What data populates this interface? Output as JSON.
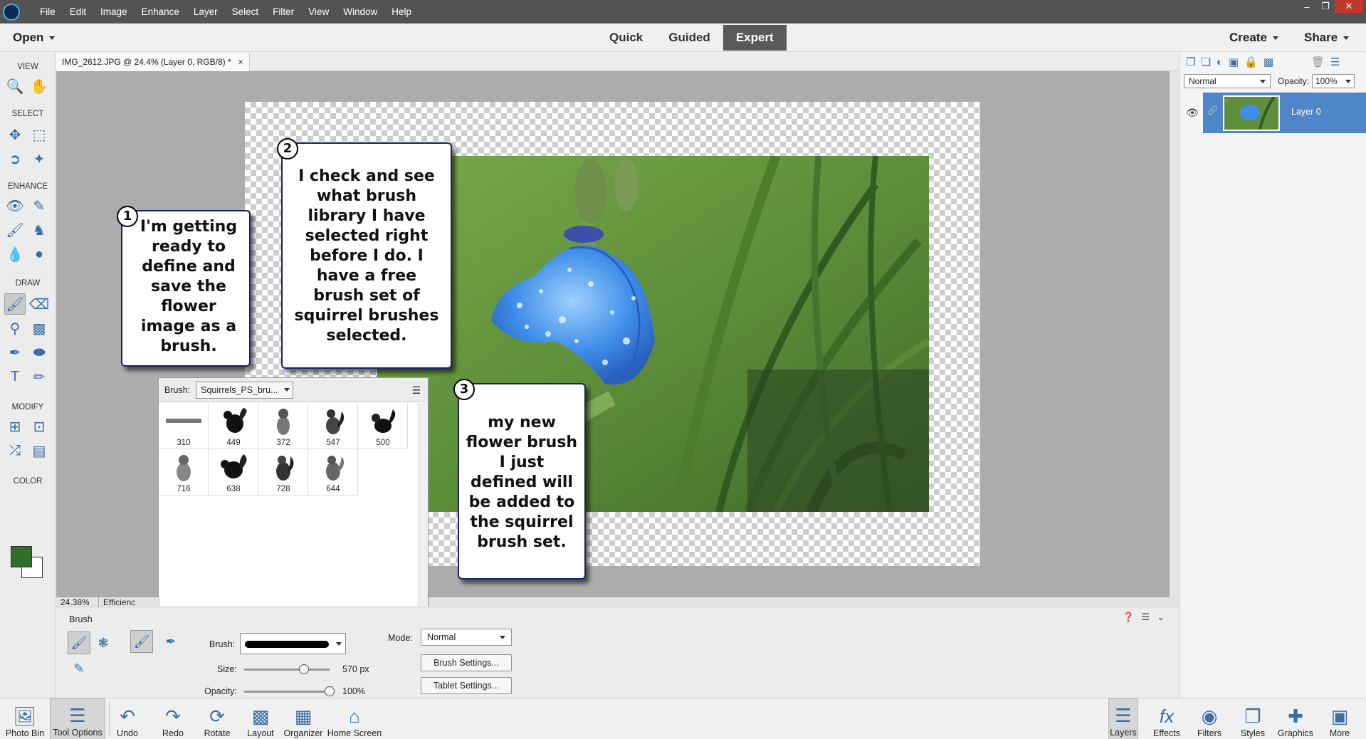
{
  "app": {
    "menu": [
      "File",
      "Edit",
      "Image",
      "Enhance",
      "Layer",
      "Select",
      "Filter",
      "View",
      "Window",
      "Help"
    ]
  },
  "topbar": {
    "open_label": "Open",
    "modes": [
      "Quick",
      "Guided",
      "Expert"
    ],
    "active_mode": "Expert",
    "create_label": "Create",
    "share_label": "Share"
  },
  "toolbox": {
    "sections": [
      "VIEW",
      "SELECT",
      "ENHANCE",
      "DRAW",
      "MODIFY",
      "COLOR"
    ],
    "fg_color": "#2f6f2a",
    "bg_color": "#ffffff"
  },
  "document": {
    "tab_title": "IMG_2612.JPG @ 24.4% (Layer 0, RGB/8) *",
    "zoom": "24.38%",
    "status_info": "Efficienc"
  },
  "callouts": [
    {
      "number": "1",
      "text": "I'm getting ready to define and save the flower image as a brush."
    },
    {
      "number": "2",
      "text": "I check and see what brush library I have selected right before I do.  I have a free brush set of squirrel brushes selected."
    },
    {
      "number": "3",
      "text": "my new flower brush I just defined will be added to the squirrel brush set."
    }
  ],
  "brush_picker": {
    "label": "Brush:",
    "library": "Squirrels_PS_bru...",
    "brushes": [
      "310",
      "449",
      "372",
      "547",
      "500",
      "716",
      "638",
      "728",
      "644"
    ]
  },
  "tool_options": {
    "title": "Brush",
    "brush_label": "Brush:",
    "size_label": "Size:",
    "size_value": "570 px",
    "size_fraction": 0.7,
    "opacity_label": "Opacity:",
    "opacity_value": "100%",
    "opacity_fraction": 1.0,
    "mode_label": "Mode:",
    "mode_value": "Normal",
    "brush_settings": "Brush Settings...",
    "tablet_settings": "Tablet Settings..."
  },
  "layers_panel": {
    "blend_mode": "Normal",
    "opacity_label": "Opacity:",
    "opacity_value": "100%",
    "layer_name": "Layer 0",
    "accent": "#4f85c9"
  },
  "taskbar": {
    "left": [
      "Photo Bin",
      "Tool Options",
      "Undo",
      "Redo",
      "Rotate",
      "Layout",
      "Organizer",
      "Home Screen"
    ],
    "right": [
      "Layers",
      "Effects",
      "Filters",
      "Styles",
      "Graphics",
      "More"
    ]
  }
}
